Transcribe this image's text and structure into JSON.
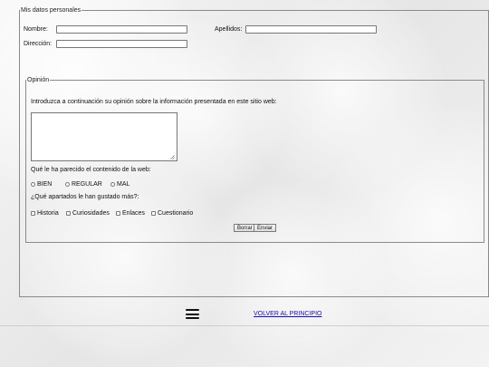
{
  "personal": {
    "legend": "Mis datos personales",
    "nombre_label": "Nombre:",
    "nombre_value": "",
    "apellidos_label": "Apellidos:",
    "apellidos_value": "",
    "direccion_label": "Dirección:",
    "direccion_value": ""
  },
  "opinion": {
    "legend": "Opinión",
    "intro": "Introduzca a continuación su opinión sobre la información presentada en este sitio web:",
    "textarea_value": "",
    "question_content": "Qué le ha parecido el contenido de la web:",
    "ratings": [
      "BIEN",
      "REGULAR",
      "MAL"
    ],
    "question_sections": "¿Qué apartados le han gustado más?:",
    "sections": [
      "Historia",
      "Curiosidades",
      "Enlaces",
      "Cuestionario"
    ],
    "reset_label": "Borrar",
    "submit_label": "Enviar"
  },
  "footer": {
    "menu_icon": "hamburger-menu-icon",
    "back_link": "VOLVER AL PRINCIPIO"
  },
  "colors": {
    "link": "#1a0dab",
    "border": "#8a8a8a"
  }
}
